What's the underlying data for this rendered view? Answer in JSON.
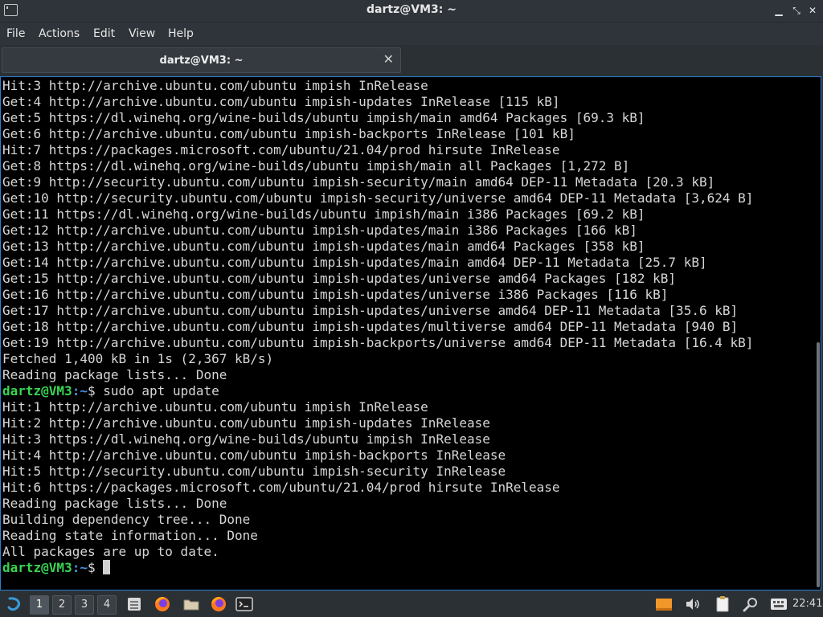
{
  "window": {
    "title": "dartz@VM3: ~"
  },
  "menu": [
    "File",
    "Actions",
    "Edit",
    "View",
    "Help"
  ],
  "tab": {
    "label": "dartz@VM3: ~"
  },
  "terminal": {
    "user_host": "dartz@VM3",
    "path_symbol": ":~",
    "prompt_symbol": "$",
    "lines": [
      "Hit:3 http://archive.ubuntu.com/ubuntu impish InRelease",
      "Get:4 http://archive.ubuntu.com/ubuntu impish-updates InRelease [115 kB]",
      "Get:5 https://dl.winehq.org/wine-builds/ubuntu impish/main amd64 Packages [69.3 kB]",
      "Get:6 http://archive.ubuntu.com/ubuntu impish-backports InRelease [101 kB]",
      "Hit:7 https://packages.microsoft.com/ubuntu/21.04/prod hirsute InRelease",
      "Get:8 https://dl.winehq.org/wine-builds/ubuntu impish/main all Packages [1,272 B]",
      "Get:9 http://security.ubuntu.com/ubuntu impish-security/main amd64 DEP-11 Metadata [20.3 kB]",
      "Get:10 http://security.ubuntu.com/ubuntu impish-security/universe amd64 DEP-11 Metadata [3,624 B]",
      "Get:11 https://dl.winehq.org/wine-builds/ubuntu impish/main i386 Packages [69.2 kB]",
      "Get:12 http://archive.ubuntu.com/ubuntu impish-updates/main i386 Packages [166 kB]",
      "Get:13 http://archive.ubuntu.com/ubuntu impish-updates/main amd64 Packages [358 kB]",
      "Get:14 http://archive.ubuntu.com/ubuntu impish-updates/main amd64 DEP-11 Metadata [25.7 kB]",
      "Get:15 http://archive.ubuntu.com/ubuntu impish-updates/universe amd64 Packages [182 kB]",
      "Get:16 http://archive.ubuntu.com/ubuntu impish-updates/universe i386 Packages [116 kB]",
      "Get:17 http://archive.ubuntu.com/ubuntu impish-updates/universe amd64 DEP-11 Metadata [35.6 kB]",
      "Get:18 http://archive.ubuntu.com/ubuntu impish-updates/multiverse amd64 DEP-11 Metadata [940 B]",
      "Get:19 http://archive.ubuntu.com/ubuntu impish-backports/universe amd64 DEP-11 Metadata [16.4 kB]",
      "Fetched 1,400 kB in 1s (2,367 kB/s)",
      "Reading package lists... Done",
      "$PROMPT sudo apt update",
      "Hit:1 http://archive.ubuntu.com/ubuntu impish InRelease",
      "Hit:2 http://archive.ubuntu.com/ubuntu impish-updates InRelease",
      "Hit:3 https://dl.winehq.org/wine-builds/ubuntu impish InRelease",
      "Hit:4 http://archive.ubuntu.com/ubuntu impish-backports InRelease",
      "Hit:5 http://security.ubuntu.com/ubuntu impish-security InRelease",
      "Hit:6 https://packages.microsoft.com/ubuntu/21.04/prod hirsute InRelease",
      "Reading package lists... Done",
      "Building dependency tree... Done",
      "Reading state information... Done",
      "All packages are up to date.",
      "$PROMPT "
    ]
  },
  "taskbar": {
    "workspaces": [
      "1",
      "2",
      "3",
      "4"
    ],
    "active_workspace": "1",
    "clock": "22:41",
    "icons": [
      "lxqt-menu-icon",
      "file-manager-icon",
      "firefox-icon",
      "folder-icon",
      "firefox-icon",
      "terminal-icon",
      "orange-app-icon",
      "volume-icon",
      "clipboard-icon",
      "search-icon",
      "keyboard-layout-icon"
    ]
  },
  "colors": {
    "prompt_green": "#39d353",
    "path_blue": "#4a90e2",
    "terminal_bg": "#000000",
    "accent": "#2a7fd4"
  }
}
